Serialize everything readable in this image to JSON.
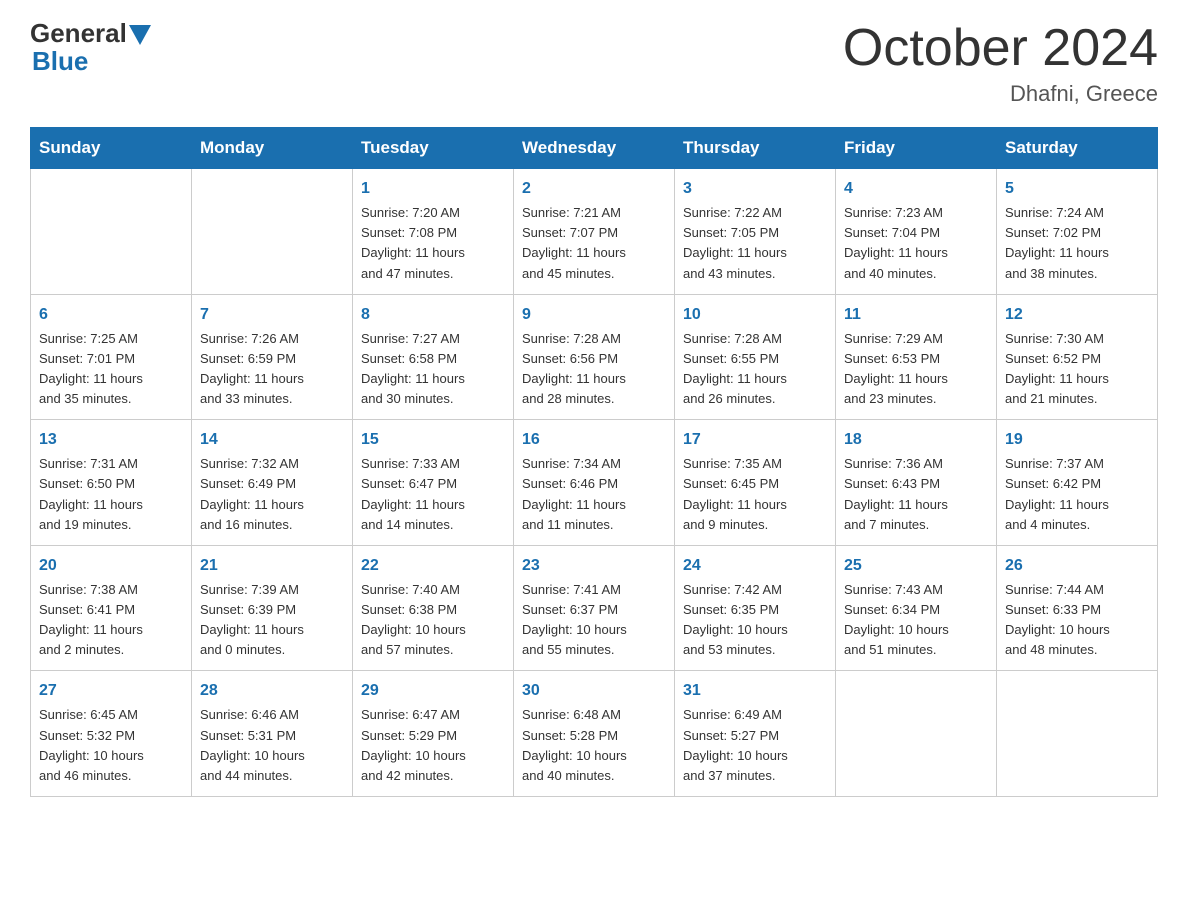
{
  "logo": {
    "text_general": "General",
    "text_blue": "Blue",
    "triangle_color": "#1a6faf"
  },
  "header": {
    "month_title": "October 2024",
    "location": "Dhafni, Greece"
  },
  "weekdays": [
    "Sunday",
    "Monday",
    "Tuesday",
    "Wednesday",
    "Thursday",
    "Friday",
    "Saturday"
  ],
  "weeks": [
    [
      {
        "day": "",
        "info": ""
      },
      {
        "day": "",
        "info": ""
      },
      {
        "day": "1",
        "info": "Sunrise: 7:20 AM\nSunset: 7:08 PM\nDaylight: 11 hours\nand 47 minutes."
      },
      {
        "day": "2",
        "info": "Sunrise: 7:21 AM\nSunset: 7:07 PM\nDaylight: 11 hours\nand 45 minutes."
      },
      {
        "day": "3",
        "info": "Sunrise: 7:22 AM\nSunset: 7:05 PM\nDaylight: 11 hours\nand 43 minutes."
      },
      {
        "day": "4",
        "info": "Sunrise: 7:23 AM\nSunset: 7:04 PM\nDaylight: 11 hours\nand 40 minutes."
      },
      {
        "day": "5",
        "info": "Sunrise: 7:24 AM\nSunset: 7:02 PM\nDaylight: 11 hours\nand 38 minutes."
      }
    ],
    [
      {
        "day": "6",
        "info": "Sunrise: 7:25 AM\nSunset: 7:01 PM\nDaylight: 11 hours\nand 35 minutes."
      },
      {
        "day": "7",
        "info": "Sunrise: 7:26 AM\nSunset: 6:59 PM\nDaylight: 11 hours\nand 33 minutes."
      },
      {
        "day": "8",
        "info": "Sunrise: 7:27 AM\nSunset: 6:58 PM\nDaylight: 11 hours\nand 30 minutes."
      },
      {
        "day": "9",
        "info": "Sunrise: 7:28 AM\nSunset: 6:56 PM\nDaylight: 11 hours\nand 28 minutes."
      },
      {
        "day": "10",
        "info": "Sunrise: 7:28 AM\nSunset: 6:55 PM\nDaylight: 11 hours\nand 26 minutes."
      },
      {
        "day": "11",
        "info": "Sunrise: 7:29 AM\nSunset: 6:53 PM\nDaylight: 11 hours\nand 23 minutes."
      },
      {
        "day": "12",
        "info": "Sunrise: 7:30 AM\nSunset: 6:52 PM\nDaylight: 11 hours\nand 21 minutes."
      }
    ],
    [
      {
        "day": "13",
        "info": "Sunrise: 7:31 AM\nSunset: 6:50 PM\nDaylight: 11 hours\nand 19 minutes."
      },
      {
        "day": "14",
        "info": "Sunrise: 7:32 AM\nSunset: 6:49 PM\nDaylight: 11 hours\nand 16 minutes."
      },
      {
        "day": "15",
        "info": "Sunrise: 7:33 AM\nSunset: 6:47 PM\nDaylight: 11 hours\nand 14 minutes."
      },
      {
        "day": "16",
        "info": "Sunrise: 7:34 AM\nSunset: 6:46 PM\nDaylight: 11 hours\nand 11 minutes."
      },
      {
        "day": "17",
        "info": "Sunrise: 7:35 AM\nSunset: 6:45 PM\nDaylight: 11 hours\nand 9 minutes."
      },
      {
        "day": "18",
        "info": "Sunrise: 7:36 AM\nSunset: 6:43 PM\nDaylight: 11 hours\nand 7 minutes."
      },
      {
        "day": "19",
        "info": "Sunrise: 7:37 AM\nSunset: 6:42 PM\nDaylight: 11 hours\nand 4 minutes."
      }
    ],
    [
      {
        "day": "20",
        "info": "Sunrise: 7:38 AM\nSunset: 6:41 PM\nDaylight: 11 hours\nand 2 minutes."
      },
      {
        "day": "21",
        "info": "Sunrise: 7:39 AM\nSunset: 6:39 PM\nDaylight: 11 hours\nand 0 minutes."
      },
      {
        "day": "22",
        "info": "Sunrise: 7:40 AM\nSunset: 6:38 PM\nDaylight: 10 hours\nand 57 minutes."
      },
      {
        "day": "23",
        "info": "Sunrise: 7:41 AM\nSunset: 6:37 PM\nDaylight: 10 hours\nand 55 minutes."
      },
      {
        "day": "24",
        "info": "Sunrise: 7:42 AM\nSunset: 6:35 PM\nDaylight: 10 hours\nand 53 minutes."
      },
      {
        "day": "25",
        "info": "Sunrise: 7:43 AM\nSunset: 6:34 PM\nDaylight: 10 hours\nand 51 minutes."
      },
      {
        "day": "26",
        "info": "Sunrise: 7:44 AM\nSunset: 6:33 PM\nDaylight: 10 hours\nand 48 minutes."
      }
    ],
    [
      {
        "day": "27",
        "info": "Sunrise: 6:45 AM\nSunset: 5:32 PM\nDaylight: 10 hours\nand 46 minutes."
      },
      {
        "day": "28",
        "info": "Sunrise: 6:46 AM\nSunset: 5:31 PM\nDaylight: 10 hours\nand 44 minutes."
      },
      {
        "day": "29",
        "info": "Sunrise: 6:47 AM\nSunset: 5:29 PM\nDaylight: 10 hours\nand 42 minutes."
      },
      {
        "day": "30",
        "info": "Sunrise: 6:48 AM\nSunset: 5:28 PM\nDaylight: 10 hours\nand 40 minutes."
      },
      {
        "day": "31",
        "info": "Sunrise: 6:49 AM\nSunset: 5:27 PM\nDaylight: 10 hours\nand 37 minutes."
      },
      {
        "day": "",
        "info": ""
      },
      {
        "day": "",
        "info": ""
      }
    ]
  ]
}
